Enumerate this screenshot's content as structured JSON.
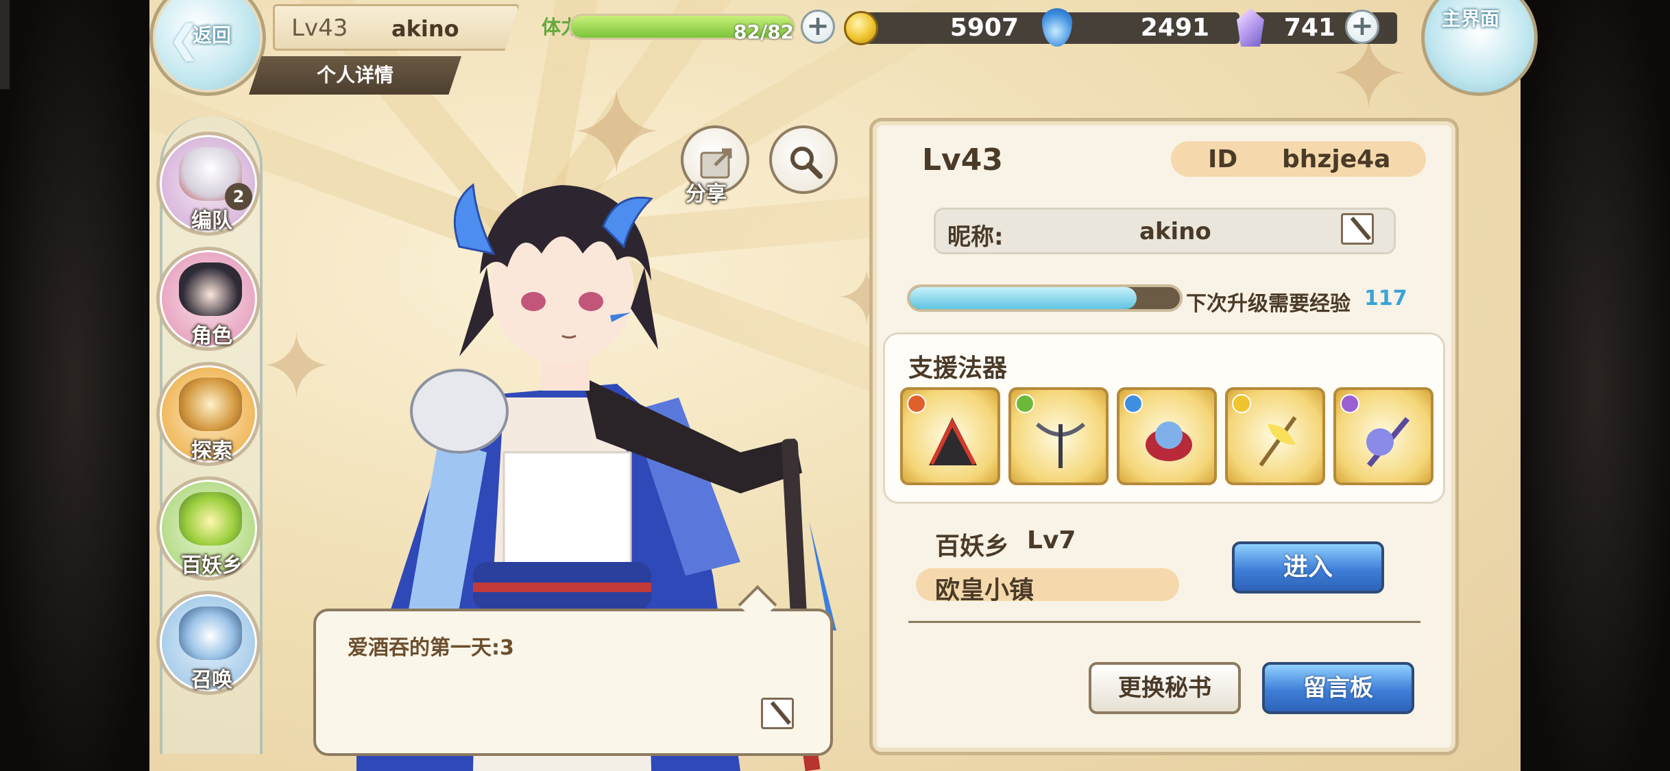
{
  "top_bar": {
    "back_label": "返回",
    "home_label": "主界面",
    "level": "Lv43",
    "player_name": "akino",
    "detail_tab": "个人详情",
    "stamina_label": "体力",
    "stamina_text": "82/82",
    "stamina_fraction": 1.0,
    "gold": "5907",
    "water": "2491",
    "gems": "741"
  },
  "left_nav": {
    "items": [
      {
        "label": "编队",
        "badge": "2",
        "icon": "team-icon"
      },
      {
        "label": "角色",
        "icon": "character-icon"
      },
      {
        "label": "探索",
        "icon": "explore-icon"
      },
      {
        "label": "百妖乡",
        "icon": "village-icon"
      },
      {
        "label": "召唤",
        "icon": "summon-icon"
      }
    ]
  },
  "actions": {
    "share_label": "分享"
  },
  "speech": {
    "text": "爱酒吞的第一天:3"
  },
  "panel": {
    "level": "Lv43",
    "id_label": "ID",
    "id_value": "bhzje4a",
    "nickname_label": "昵称:",
    "nickname_value": "akino",
    "exp_fraction": 0.84,
    "exp_label": "下次升级需要经验",
    "exp_value": "117",
    "support_title": "支援法器",
    "support_items": [
      {
        "icon": "war-fan-icon",
        "element_color": "#e0602c"
      },
      {
        "icon": "crossbow-icon",
        "element_color": "#6cb83a"
      },
      {
        "icon": "spirit-dragon-icon",
        "element_color": "#3f8fe0"
      },
      {
        "icon": "golden-lily-sword-icon",
        "element_color": "#f0c42e"
      },
      {
        "icon": "moon-sword-icon",
        "element_color": "#9a5fd0"
      }
    ],
    "village_name": "百妖乡",
    "village_level": "Lv7",
    "town_name": "欧皇小镇",
    "enter_label": "进入",
    "change_secretary_label": "更换秘书",
    "message_board_label": "留言板"
  }
}
